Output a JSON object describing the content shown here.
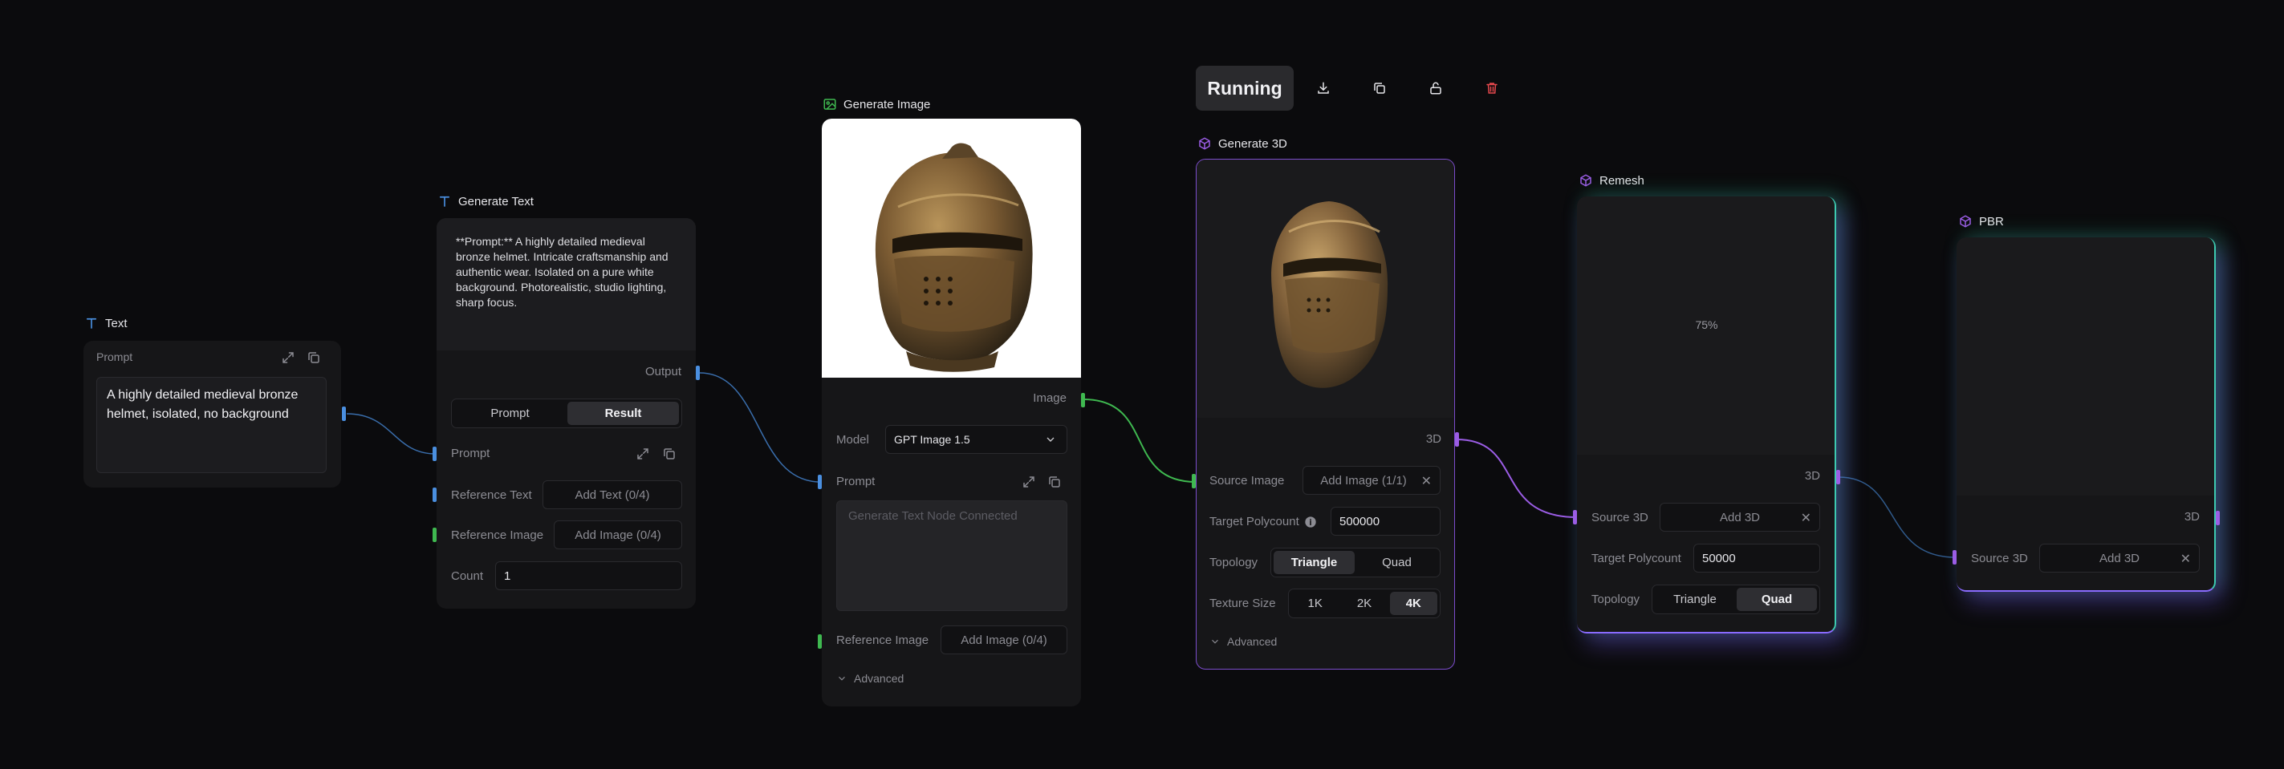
{
  "toolbar": {
    "running_label": "Running",
    "icons": [
      "download-icon",
      "copy-icon",
      "unlock-icon",
      "trash-icon"
    ],
    "trash_color": "#e5484d"
  },
  "colors": {
    "text_port": "#4a8fe0",
    "image_port": "#3fb950",
    "model3d_port": "#9b5de5",
    "selected_border": "#7c4dcc",
    "glow_green": "#2ee59d",
    "glow_purple": "#7b5cff"
  },
  "text_node": {
    "title": "Text",
    "icon": "text-icon",
    "prompt_label": "Prompt",
    "prompt_value": "A highly detailed medieval bronze helmet, isolated, no background"
  },
  "generate_text_node": {
    "title": "Generate Text",
    "icon": "text-icon",
    "result_text": "**Prompt:** A highly detailed medieval bronze helmet. Intricate craftsmanship and authentic wear. Isolated on a pure white background. Photorealistic, studio lighting, sharp focus.",
    "output_label": "Output",
    "tabs": [
      "Prompt",
      "Result"
    ],
    "active_tab": "Result",
    "prompt_label": "Prompt",
    "reference_text_label": "Reference Text",
    "reference_text_button": "Add Text (0/4)",
    "reference_image_label": "Reference Image",
    "reference_image_button": "Add Image (0/4)",
    "count_label": "Count",
    "count_value": "1"
  },
  "generate_image_node": {
    "title": "Generate Image",
    "icon": "image-icon",
    "output_label": "Image",
    "model_label": "Model",
    "model_value": "GPT Image 1.5",
    "prompt_label": "Prompt",
    "prompt_placeholder": "Generate Text Node Connected",
    "reference_image_label": "Reference Image",
    "reference_image_button": "Add Image (0/4)",
    "advanced_label": "Advanced"
  },
  "generate_3d_node": {
    "title": "Generate 3D",
    "icon": "cube-icon",
    "output_label": "3D",
    "source_image_label": "Source Image",
    "source_image_button": "Add Image (1/1)",
    "target_polycount_label": "Target Polycount",
    "target_polycount_value": "500000",
    "topology_label": "Topology",
    "topology_options": [
      "Triangle",
      "Quad"
    ],
    "topology_active": "Triangle",
    "texture_size_label": "Texture Size",
    "texture_options": [
      "1K",
      "2K",
      "4K"
    ],
    "texture_active": "4K",
    "advanced_label": "Advanced"
  },
  "remesh_node": {
    "title": "Remesh",
    "icon": "cube-icon",
    "progress_text": "75%",
    "progress": 0.75,
    "output_label": "3D",
    "source_3d_label": "Source 3D",
    "source_3d_button": "Add 3D",
    "target_polycount_label": "Target Polycount",
    "target_polycount_value": "50000",
    "topology_label": "Topology",
    "topology_options": [
      "Triangle",
      "Quad"
    ],
    "topology_active": "Quad"
  },
  "pbr_node": {
    "title": "PBR",
    "icon": "cube-icon",
    "output_label": "3D",
    "source_3d_label": "Source 3D",
    "source_3d_button": "Add 3D"
  }
}
